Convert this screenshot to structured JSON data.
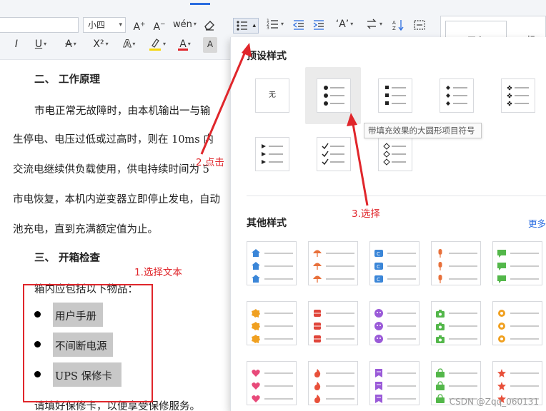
{
  "toolbar": {
    "font_size_value": "小四",
    "grow_font_icon": "A⁺",
    "shrink_font_icon": "A⁻",
    "phonetic_icon": "wén",
    "clear_format_icon": "eraser",
    "italic_icon": "I",
    "underline_icon": "U",
    "strikethrough_icon": "A",
    "superscript_icon": "X²",
    "text_effect_icon": "A",
    "highlight_icon": "ab",
    "font_color_icon": "A",
    "char_shading_icon": "A",
    "accent_color": "#2b6de0",
    "highlight_color": "#f5d60c",
    "font_color": "#e0262b"
  },
  "styles_gallery": {
    "card1": "正文",
    "card2": "标"
  },
  "document": {
    "heading2": "二、    工作原理",
    "para1": [
      "市电正常无故障时，由本机输出一与输",
      "生停电、电压过低或过高时，则在 10ms 内",
      "交流电继续供负载使用，供电持续时间为 5",
      "市电恢复，本机内逆变器立即停止发电，自动",
      "池充电，直到充满额定值为止。"
    ],
    "heading3": "三、    开箱检查",
    "para2": "箱内应包括以下物品：",
    "bullets": [
      "用户手册",
      "不间断电源",
      "UPS 保修卡"
    ],
    "para3": "请填好保修卡，以便享受保修服务。"
  },
  "annotations": {
    "step1": "1.选择文本",
    "step2": "2.点击",
    "step3": "3.选择",
    "color": "#e0262b"
  },
  "bullet_panel": {
    "preset_title": "预设样式",
    "none_label": "无",
    "tooltip": "带填充效果的大圆形项目符号",
    "other_title": "其他样式",
    "more_link": "更多",
    "other_styles": [
      {
        "icon": "house-icon",
        "color": "#3b86d8"
      },
      {
        "icon": "umbrella-icon",
        "color": "#e8703a"
      },
      {
        "icon": "card-icon",
        "color": "#3b86d8"
      },
      {
        "icon": "microphone-icon",
        "color": "#e8703a"
      },
      {
        "icon": "chat-bubble-icon",
        "color": "#53b74a"
      },
      {
        "icon": "checkbadge-icon",
        "color": "#f0a020"
      },
      {
        "icon": "cylinder-icon",
        "color": "#e0453a"
      },
      {
        "icon": "smiley-icon",
        "color": "#9a5ad8"
      },
      {
        "icon": "camera-icon",
        "color": "#53b74a"
      },
      {
        "icon": "gear-icon",
        "color": "#f0a020"
      },
      {
        "icon": "heart-icon",
        "color": "#e84a7a"
      },
      {
        "icon": "flame-icon",
        "color": "#e8503a"
      },
      {
        "icon": "bookmark-icon",
        "color": "#9a5ad8"
      },
      {
        "icon": "bag-icon",
        "color": "#53b74a"
      },
      {
        "icon": "star-icon",
        "color": "#e8503a"
      }
    ]
  },
  "watermark": "CSDN @Zqq_060131"
}
